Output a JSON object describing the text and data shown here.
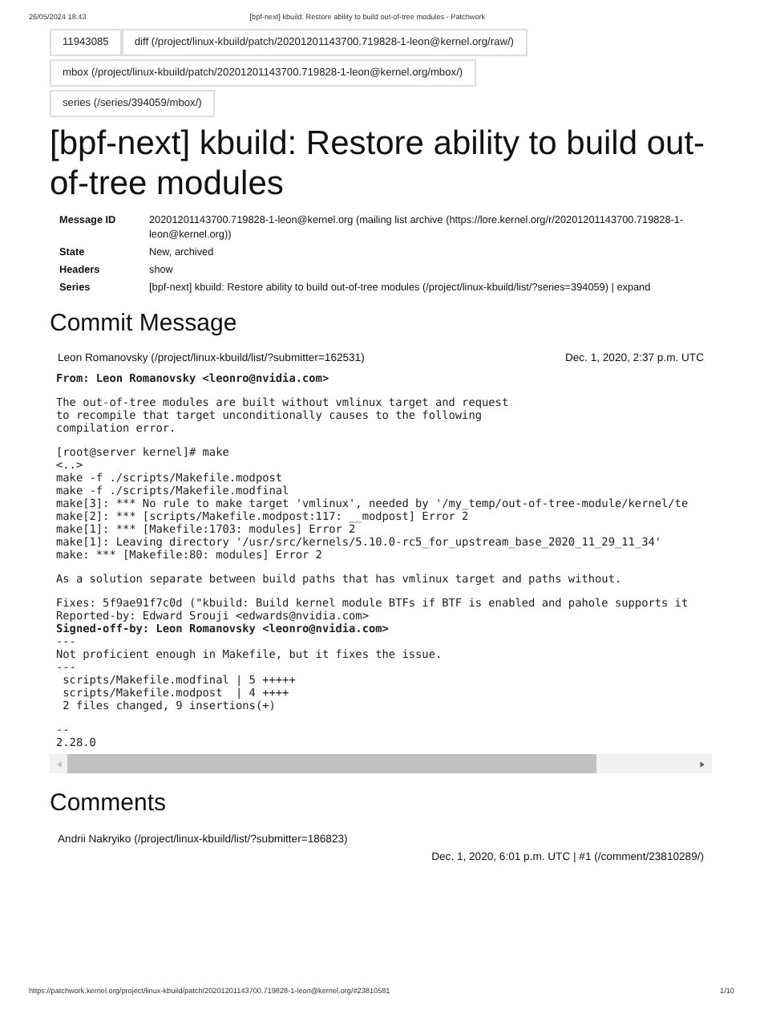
{
  "print_header": {
    "date": "26/05/2024 18:43",
    "title": "[bpf-next] kbuild: Restore ability to build out-of-tree modules - Patchwork"
  },
  "link_rows": [
    [
      "11943085",
      "diff (/project/linux-kbuild/patch/20201201143700.719828-1-leon@kernel.org/raw/)"
    ],
    [
      "mbox (/project/linux-kbuild/patch/20201201143700.719828-1-leon@kernel.org/mbox/)"
    ],
    [
      "series (/series/394059/mbox/)"
    ]
  ],
  "title": "[bpf-next] kbuild: Restore ability to build out-of-tree modules",
  "meta": [
    {
      "label": "Message ID",
      "value": "20201201143700.719828-1-leon@kernel.org (mailing list archive (https://lore.kernel.org/r/20201201143700.719828-1-leon@kernel.org))"
    },
    {
      "label": "State",
      "value": "New, archived"
    },
    {
      "label": "Headers",
      "value": "show"
    },
    {
      "label": "Series",
      "value": "[bpf-next] kbuild: Restore ability to build out-of-tree modules (/project/linux-kbuild/list/?series=394059) | expand"
    }
  ],
  "commit_heading": "Commit Message",
  "commit_author": "Leon Romanovsky (/project/linux-kbuild/list/?submitter=162531)",
  "commit_date": "Dec. 1, 2020, 2:37 p.m. UTC",
  "commit_paragraphs": [
    [
      {
        "text": "From: Leon Romanovsky <leonro@nvidia.com>",
        "bold": true
      }
    ],
    [
      {
        "text": "The out-of-tree modules are built without vmlinux target and request",
        "bold": false
      },
      {
        "text": "to recompile that target unconditionally causes to the following",
        "bold": false
      },
      {
        "text": "compilation error.",
        "bold": false
      }
    ],
    [
      {
        "text": "[root@server kernel]# make",
        "bold": false
      },
      {
        "text": "<..>",
        "bold": false
      },
      {
        "text": "make -f ./scripts/Makefile.modpost",
        "bold": false
      },
      {
        "text": "make -f ./scripts/Makefile.modfinal",
        "bold": false
      },
      {
        "text": "make[3]: *** No rule to make target 'vmlinux', needed by '/my_temp/out-of-tree-module/kernel/te",
        "bold": false
      },
      {
        "text": "make[2]: *** [scripts/Makefile.modpost:117: __modpost] Error 2",
        "bold": false
      },
      {
        "text": "make[1]: *** [Makefile:1703: modules] Error 2",
        "bold": false
      },
      {
        "text": "make[1]: Leaving directory '/usr/src/kernels/5.10.0-rc5_for_upstream_base_2020_11_29_11_34'",
        "bold": false
      },
      {
        "text": "make: *** [Makefile:80: modules] Error 2",
        "bold": false
      }
    ],
    [
      {
        "text": "As a solution separate between build paths that has vmlinux target and paths without.",
        "bold": false
      }
    ],
    [
      {
        "text": "Fixes: 5f9ae91f7c0d (\"kbuild: Build kernel module BTFs if BTF is enabled and pahole supports it",
        "bold": false
      },
      {
        "text": "Reported-by: Edward Srouji <edwards@nvidia.com>",
        "bold": false
      },
      {
        "text": "Signed-off-by: Leon Romanovsky <leonro@nvidia.com>",
        "bold": true
      },
      {
        "text": "---",
        "bold": false
      },
      {
        "text": "Not proficient enough in Makefile, but it fixes the issue.",
        "bold": false
      },
      {
        "text": "---",
        "bold": false
      },
      {
        "text": " scripts/Makefile.modfinal | 5 +++++",
        "bold": false
      },
      {
        "text": " scripts/Makefile.modpost  | 4 ++++",
        "bold": false
      },
      {
        "text": " 2 files changed, 9 insertions(+)",
        "bold": false
      }
    ],
    [
      {
        "text": "--",
        "bold": false
      },
      {
        "text": "2.28.0",
        "bold": false
      }
    ]
  ],
  "comments_heading": "Comments",
  "comments": [
    {
      "author": "Andrii Nakryiko (/project/linux-kbuild/list/?submitter=186823)",
      "date": "Dec. 1, 2020, 6:01 p.m. UTC | #1 (/comment/23810289/)"
    }
  ],
  "print_footer": {
    "url": "https://patchwork.kernel.org/project/linux-kbuild/patch/20201201143700.719828-1-leon@kernel.org/#23810581",
    "page": "1/10"
  }
}
